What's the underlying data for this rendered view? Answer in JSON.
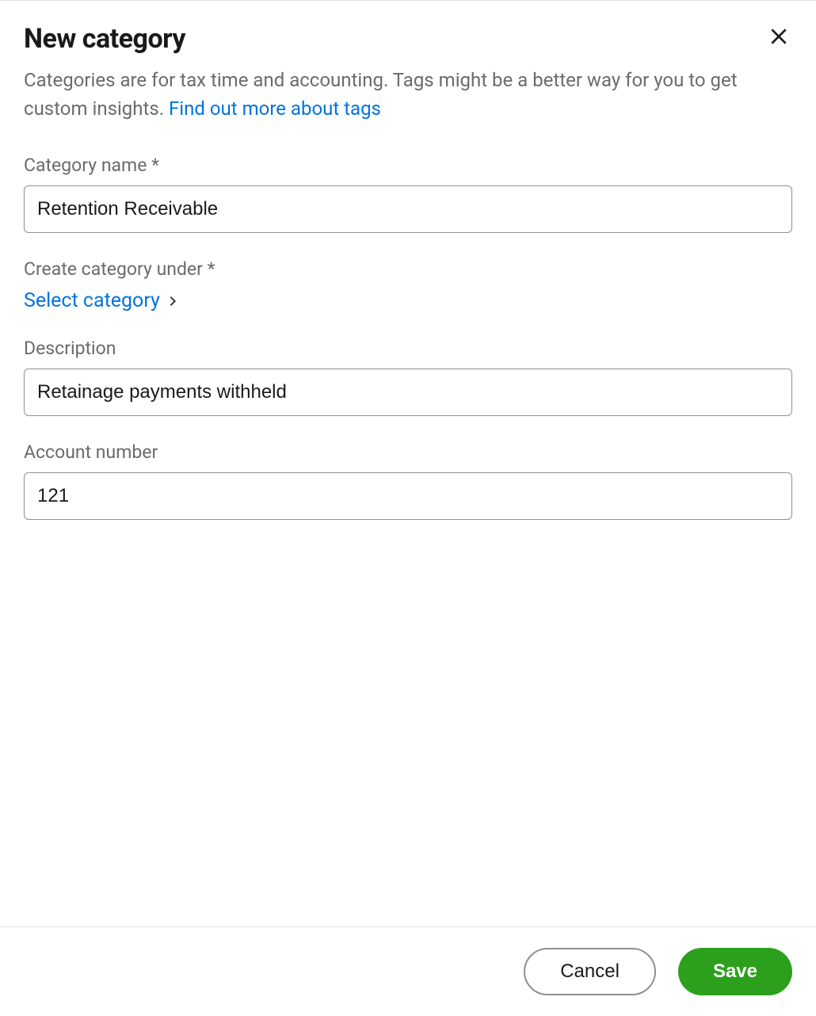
{
  "header": {
    "title": "New category",
    "subtitle_part1": "Categories are for tax time and accounting. Tags might be a better way for you to get custom insights. ",
    "subtitle_link": "Find out more about tags"
  },
  "fields": {
    "category_name": {
      "label": "Category name *",
      "value": "Retention Receivable"
    },
    "create_under": {
      "label": "Create category under *",
      "link_text": "Select category"
    },
    "description": {
      "label": "Description",
      "value": "Retainage payments withheld"
    },
    "account_number": {
      "label": "Account number",
      "value": "121"
    }
  },
  "footer": {
    "cancel": "Cancel",
    "save": "Save"
  }
}
